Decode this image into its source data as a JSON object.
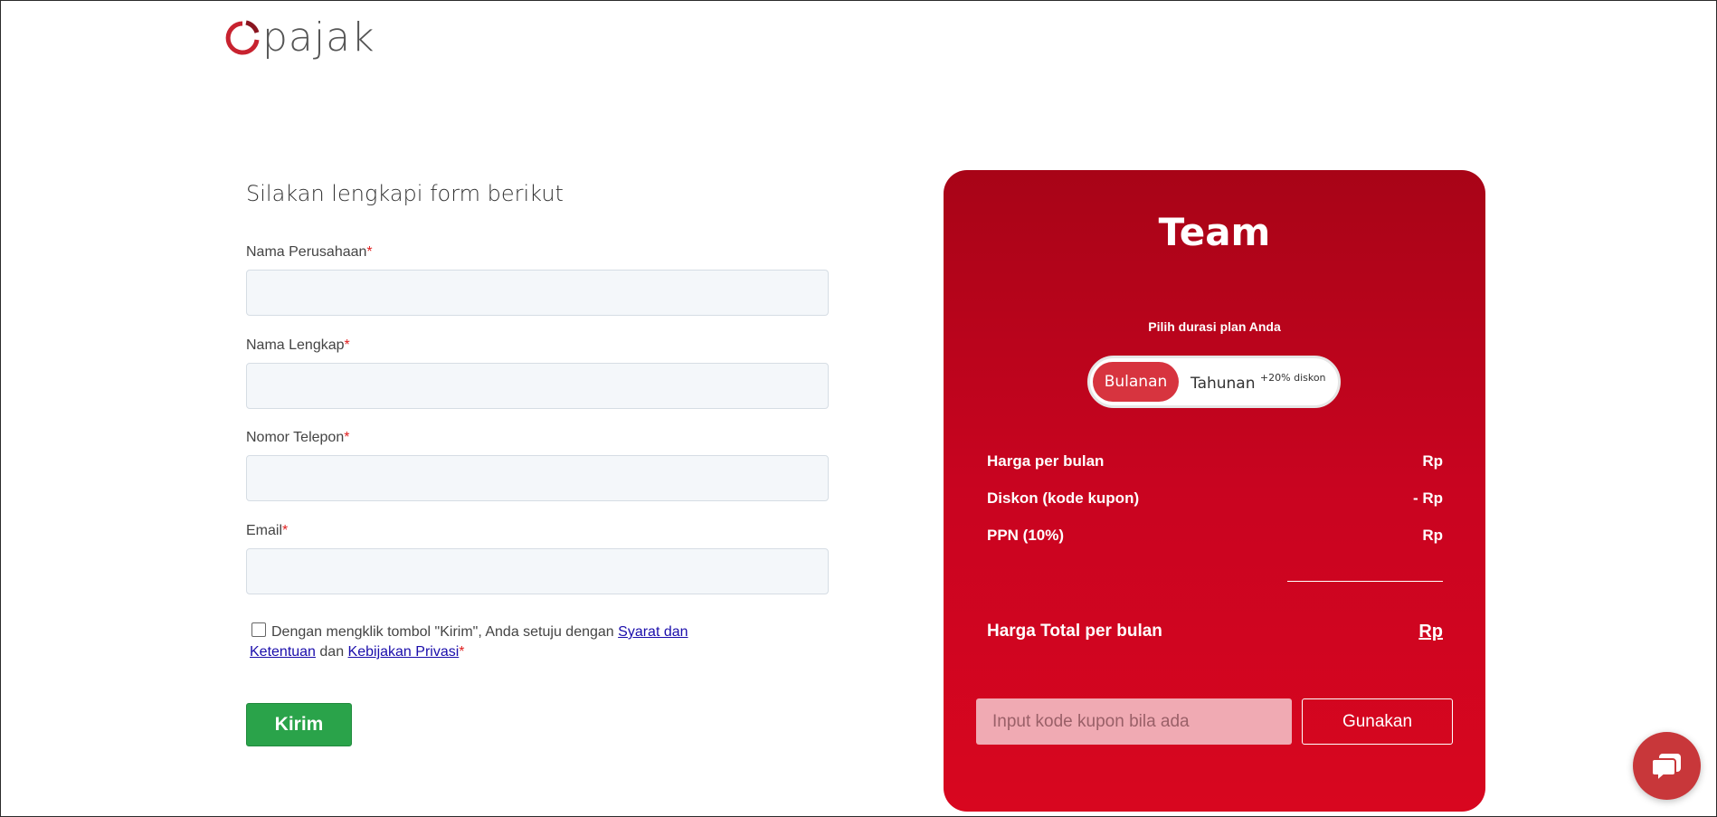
{
  "logo": {
    "text": "pajak"
  },
  "form": {
    "title": "Silakan lengkapi form berikut",
    "fields": [
      {
        "label": "Nama Perusahaan",
        "required_mark": "*",
        "value": ""
      },
      {
        "label": "Nama Lengkap",
        "required_mark": "*",
        "value": ""
      },
      {
        "label": "Nomor Telepon",
        "required_mark": "*",
        "value": ""
      },
      {
        "label": "Email",
        "required_mark": "*",
        "value": ""
      }
    ],
    "agreement": {
      "text_before": "Dengan mengklik tombol \"Kirim\", Anda setuju dengan ",
      "link_terms": "Syarat dan Ketentuan",
      "text_middle": " dan ",
      "link_privacy": "Kebijakan Privasi",
      "required_mark": "*",
      "checked": false
    },
    "submit_label": "Kirim"
  },
  "plan": {
    "name": "Team",
    "duration_label": "Pilih durasi plan Anda",
    "toggle": {
      "active": "Bulanan",
      "inactive": "Tahunan",
      "inactive_badge": "+20% diskon"
    },
    "rows": [
      {
        "label": "Harga per bulan",
        "value": "Rp"
      },
      {
        "label": "Diskon (kode kupon)",
        "value": "- Rp"
      },
      {
        "label": "PPN (10%)",
        "value": "Rp"
      }
    ],
    "total": {
      "label": "Harga Total per bulan",
      "value": "Rp"
    },
    "coupon": {
      "placeholder": "Input kode kupon bila ada",
      "button_label": "Gunakan"
    }
  },
  "colors": {
    "brand_red": "#c90420",
    "submit_green": "#2aa34a",
    "chat_red": "#c8373a"
  },
  "icons": {
    "chat": "chat-bubble-icon",
    "logo": "pajak-logo-icon"
  }
}
